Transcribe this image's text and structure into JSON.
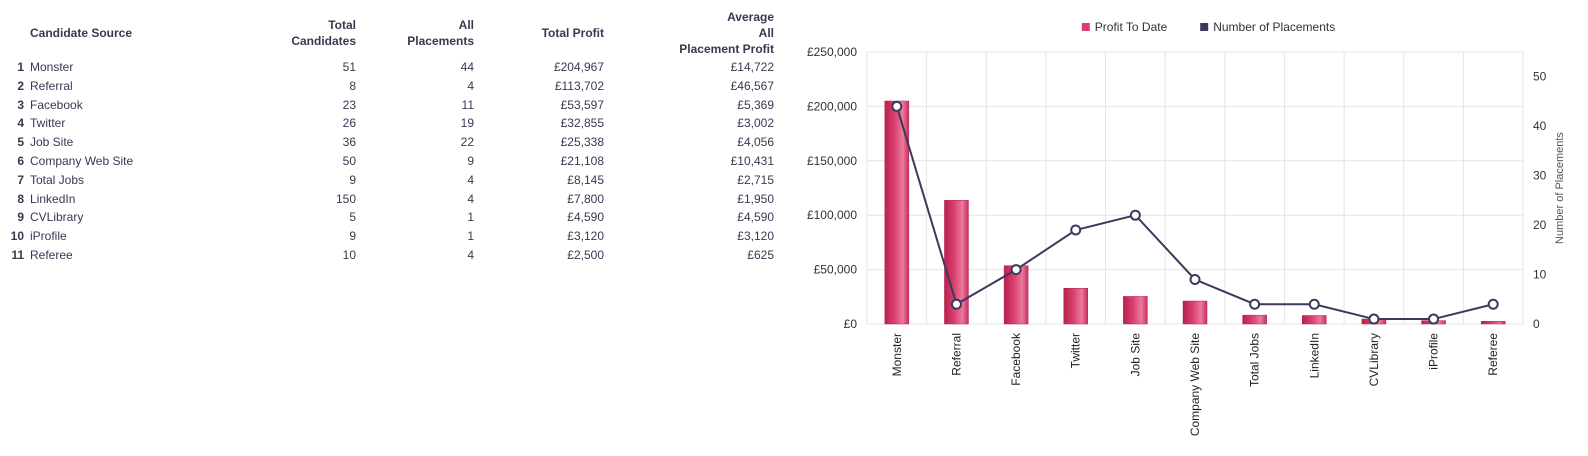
{
  "table": {
    "headers": {
      "index": "",
      "source": "Candidate Source",
      "total_candidates": [
        "Total",
        "Candidates"
      ],
      "all_placements": [
        "All",
        "Placements"
      ],
      "total_profit": "Total Profit",
      "avg_profit": [
        "Average",
        "All",
        "Placement Profit"
      ]
    },
    "rows": [
      {
        "idx": "1",
        "source": "Monster",
        "total_candidates": "51",
        "all_placements": "44",
        "total_profit": "£204,967",
        "avg_profit": "£14,722"
      },
      {
        "idx": "2",
        "source": "Referral",
        "total_candidates": "8",
        "all_placements": "4",
        "total_profit": "£113,702",
        "avg_profit": "£46,567"
      },
      {
        "idx": "3",
        "source": "Facebook",
        "total_candidates": "23",
        "all_placements": "11",
        "total_profit": "£53,597",
        "avg_profit": "£5,369"
      },
      {
        "idx": "4",
        "source": "Twitter",
        "total_candidates": "26",
        "all_placements": "19",
        "total_profit": "£32,855",
        "avg_profit": "£3,002"
      },
      {
        "idx": "5",
        "source": "Job Site",
        "total_candidates": "36",
        "all_placements": "22",
        "total_profit": "£25,338",
        "avg_profit": "£4,056"
      },
      {
        "idx": "6",
        "source": "Company Web Site",
        "total_candidates": "50",
        "all_placements": "9",
        "total_profit": "£21,108",
        "avg_profit": "£10,431"
      },
      {
        "idx": "7",
        "source": "Total Jobs",
        "total_candidates": "9",
        "all_placements": "4",
        "total_profit": "£8,145",
        "avg_profit": "£2,715"
      },
      {
        "idx": "8",
        "source": "LinkedIn",
        "total_candidates": "150",
        "all_placements": "4",
        "total_profit": "£7,800",
        "avg_profit": "£1,950"
      },
      {
        "idx": "9",
        "source": "CVLibrary",
        "total_candidates": "5",
        "all_placements": "1",
        "total_profit": "£4,590",
        "avg_profit": "£4,590"
      },
      {
        "idx": "10",
        "source": "iProfile",
        "total_candidates": "9",
        "all_placements": "1",
        "total_profit": "£3,120",
        "avg_profit": "£3,120"
      },
      {
        "idx": "11",
        "source": "Referee",
        "total_candidates": "10",
        "all_placements": "4",
        "total_profit": "£2,500",
        "avg_profit": "£625"
      }
    ]
  },
  "chart_data": {
    "type": "bar",
    "categories": [
      "Monster",
      "Referral",
      "Facebook",
      "Twitter",
      "Job Site",
      "Company Web Site",
      "Total Jobs",
      "LinkedIn",
      "CVLibrary",
      "iProfile",
      "Referee"
    ],
    "series": [
      {
        "name": "Profit To Date",
        "type": "bar",
        "axis": "left",
        "color": "#d9406e",
        "values": [
          204967,
          113702,
          53597,
          32855,
          25338,
          21108,
          8145,
          7800,
          4590,
          3120,
          2500
        ]
      },
      {
        "name": "Number of Placements",
        "type": "line",
        "axis": "right",
        "color": "#3b3a5c",
        "values": [
          44,
          4,
          11,
          19,
          22,
          9,
          4,
          4,
          1,
          1,
          4
        ]
      }
    ],
    "left_axis": {
      "ylim": [
        0,
        250000
      ],
      "ticks": [
        0,
        50000,
        100000,
        150000,
        200000,
        250000
      ],
      "tick_labels": [
        "£0",
        "£50,000",
        "£100,000",
        "£150,000",
        "£200,000",
        "£250,000"
      ]
    },
    "right_axis": {
      "ylim": [
        0,
        55
      ],
      "ticks": [
        0,
        10,
        20,
        30,
        40,
        50
      ],
      "tick_labels": [
        "0",
        "10",
        "20",
        "30",
        "40",
        "50"
      ],
      "label": "Number of Placements"
    },
    "legend_position": "top-center",
    "grid": true
  }
}
